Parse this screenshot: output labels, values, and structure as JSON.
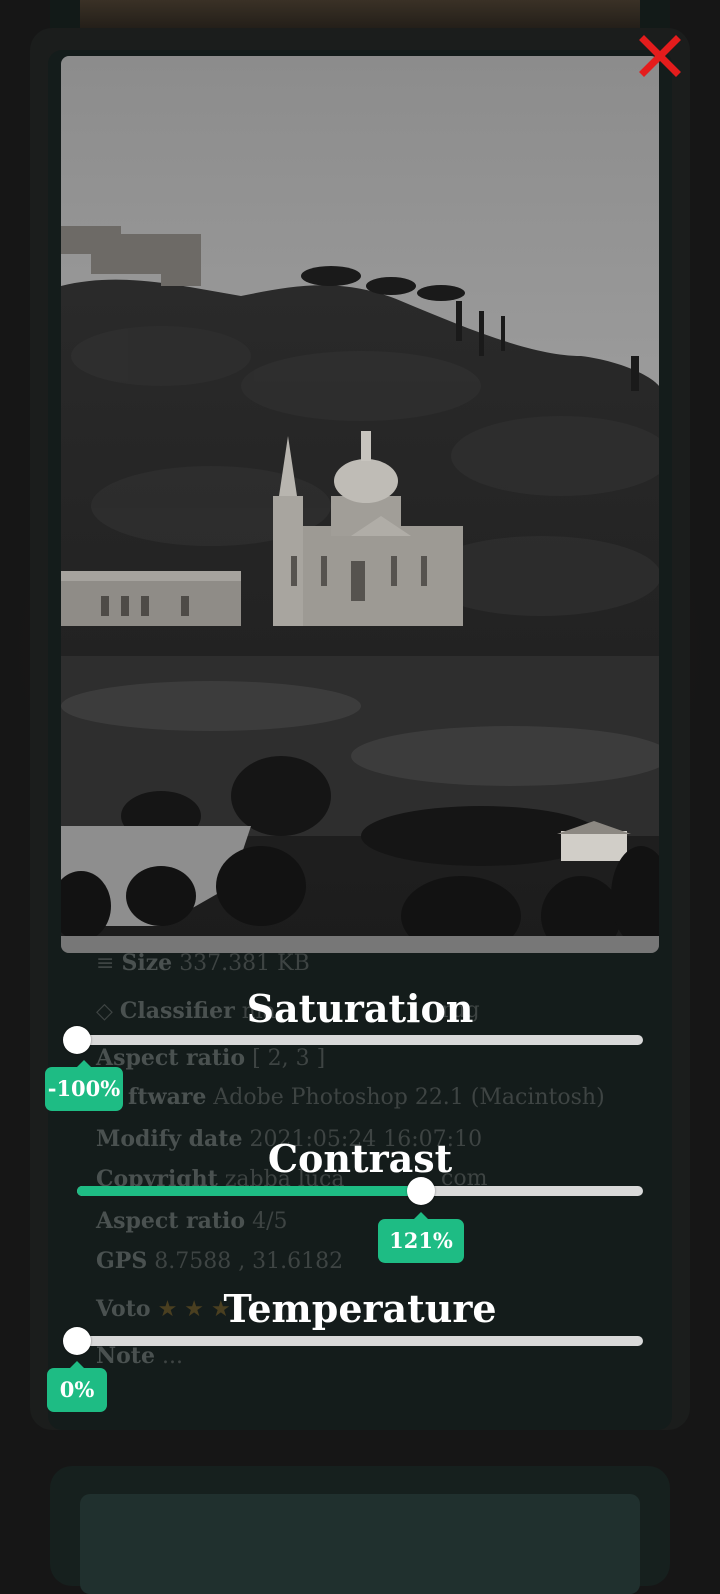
{
  "close_icon": "close-icon",
  "accent_color": "#1ebc84",
  "close_color": "#e41c1c",
  "photo": {
    "description_icon": "photo"
  },
  "metadata": {
    "size_icon": "≡",
    "size_label": "Size",
    "size_value": "337.381 KB",
    "classifier_icon": "◇",
    "classifier_label": "Classifier",
    "classifier_value": "ma",
    "classifier_tail": "rug",
    "aspect1_label": "Aspect ratio",
    "aspect1_value": "[ 2, 3 ]",
    "software_label": "ftware",
    "software_value": "Adobe Photoshop 22.1 (Macintosh)",
    "modify_label": "Modify date",
    "modify_value": "2021:05:24 16:07:10",
    "copyright_label": "Copyright",
    "copyright_value": "zabba luca",
    "copyright_tail": "com",
    "aspect2_label": "Aspect ratio",
    "aspect2_value": "4/5",
    "gps_label": "GPS",
    "gps_value": "8.7588 , 31.6182",
    "vote_label": "Voto",
    "stars": "★ ★ ★",
    "note_label": "Note",
    "note_value": "..."
  },
  "sliders": {
    "saturation": {
      "title": "Saturation",
      "value_label": "-100%",
      "level": 0.0
    },
    "contrast": {
      "title": "Contrast",
      "value_label": "121%",
      "level": 0.61
    },
    "temperature": {
      "title": "Temperature",
      "value_label": "0%",
      "level": 0.0
    }
  }
}
